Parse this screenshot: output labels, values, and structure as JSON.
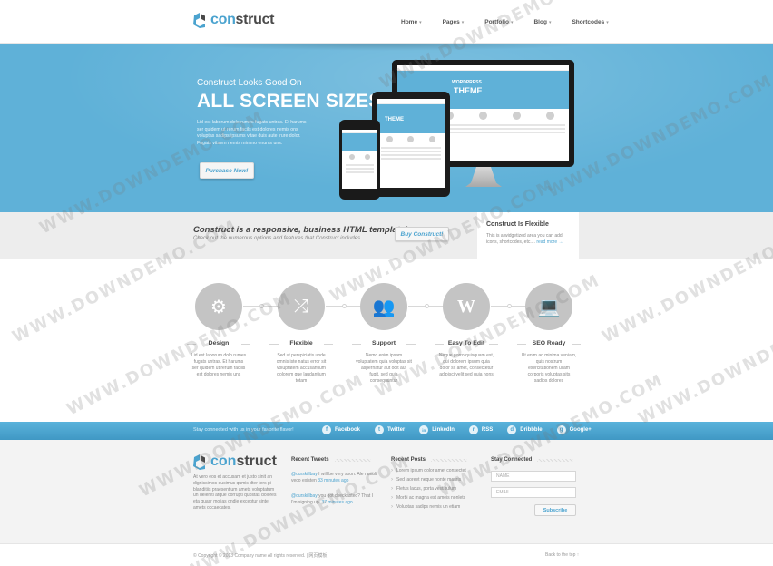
{
  "brand": {
    "name_prefix": "con",
    "name_suffix": "struct",
    "accent": "#4ba3cf",
    "hero_bg": "#5fb1d8"
  },
  "nav": [
    {
      "label": "Home",
      "caret": "▾"
    },
    {
      "label": "Pages",
      "caret": "▾"
    },
    {
      "label": "Portfolio",
      "caret": "▾"
    },
    {
      "label": "Blog",
      "caret": "▾"
    },
    {
      "label": "Shortcodes",
      "caret": "▾"
    }
  ],
  "hero": {
    "kicker": "Construct Looks Good On",
    "headline": "ALL SCREEN SIZES",
    "blurb": "Lid est laborum dolo rumes fugats untras. Et harums ser quidem ut rerum facils est dolores nemis ons voluptas sadips ipsums vitae duis aute irure dolor. Fugats vitaem nemis minimo enums uns.",
    "button": "Purchase Now!",
    "screen_word": "THEME",
    "screen_word_big": "WORDPRESS"
  },
  "promo": {
    "title": "Construct is a responsive, business HTML template!",
    "subtitle": "Check out the numerous options and features that Construct includes.",
    "button": "Buy Construct!"
  },
  "widget": {
    "title": "Construct Is Flexible",
    "text": "This is a widgetized area you can add icons, shortcodes, etc....",
    "link": "read more →"
  },
  "features": [
    {
      "icon": "gear-icon",
      "glyph": "⚙",
      "title": "Design",
      "text": "Lid est laborum dolo rumes fugats untras. Et harums ser quidem ut rerum facilis est dolores nemis uns"
    },
    {
      "icon": "shuffle-icon",
      "glyph": "⤮",
      "title": "Flexible",
      "text": "Sed ut perspiciatis unde omnis iste natus error sit voluptatem accusantium dolorem que laudantium totam"
    },
    {
      "icon": "users-icon",
      "glyph": "👥",
      "title": "Support",
      "text": "Nemo enim ipsam voluptatem quia voluptas sit aspernatur aut odit aut fugit, sed quia consequuntur"
    },
    {
      "icon": "wordpress-icon",
      "glyph": "W",
      "title": "Easy To Edit",
      "text": "Neque porro quisquam est, qui dolorem ipsum quia dolor sit amet, consectetur adipisci velit sed quia nons"
    },
    {
      "icon": "laptop-icon",
      "glyph": "💻",
      "title": "SEO Ready",
      "text": "Ut enim ad minima veniam, quis nostrum exercitationem ullam corporis voluptas sits sadips dolores"
    }
  ],
  "social": {
    "tagline": "Stay connected with us in your favorite flavor!",
    "links": [
      {
        "label": "Facebook",
        "glyph": "f",
        "icon": "facebook-icon"
      },
      {
        "label": "Twitter",
        "glyph": "t",
        "icon": "twitter-icon"
      },
      {
        "label": "LinkedIn",
        "glyph": "in",
        "icon": "linkedin-icon"
      },
      {
        "label": "RSS",
        "glyph": "r",
        "icon": "rss-icon"
      },
      {
        "label": "Dribbble",
        "glyph": "d",
        "icon": "dribbble-icon"
      },
      {
        "label": "Google+",
        "glyph": "g",
        "icon": "google-plus-icon"
      }
    ]
  },
  "footer": {
    "about": "At vero eos et accusam et justo sinit an dignissimos ducimus qumis dter ters pi blanditiis praesentium amets voluptatum un deleniti atque corrupti quostas dolores eta quasr molias ondie exceptur sinte amets occaecates.",
    "tweets_title": "Recent Tweets",
    "tweets": [
      {
        "handle": "@ourskillbay",
        "text": " I will be very soon. Ale nosult veco existen ",
        "time": "33 minutes ago"
      },
      {
        "handle": "@ourskillbay",
        "text": " you got checkasted? That I I'm signing up. ",
        "time": "37 minutes ago"
      }
    ],
    "posts_title": "Recent Posts",
    "posts": [
      "Lorem ipsum dolor amet consectet",
      "Sed laoreet neque nonte mauris",
      "Fletus lacus, porta vestibulum",
      "Morbi ac magna est ameis nonlets",
      "Voluptas sadips nemis un etiam"
    ],
    "connect_title": "Stay Connected",
    "name_placeholder": "NAME",
    "email_placeholder": "EMAIL",
    "subscribe": "Subscribe"
  },
  "bottom": {
    "copyright": "© Copyright © 2013 Company name All rights reserved. | 网页模板",
    "back_to_top": "Back to the top ↑"
  },
  "watermark": "WWW.DOWNDEMO.COM"
}
